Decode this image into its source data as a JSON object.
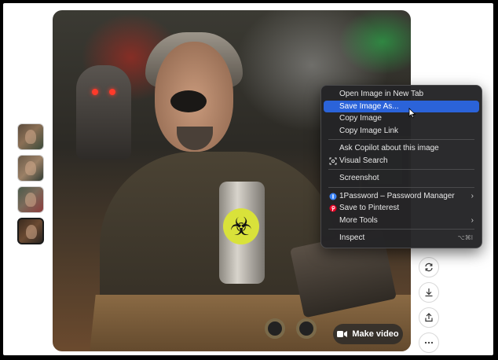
{
  "thumbnails": [
    {
      "alt": "thumbnail 1"
    },
    {
      "alt": "thumbnail 2"
    },
    {
      "alt": "thumbnail 3"
    },
    {
      "alt": "thumbnail 4",
      "selected": true
    }
  ],
  "image": {
    "make_video_label": "Make video"
  },
  "context_menu": {
    "items": [
      {
        "label": "Open Image in New Tab"
      },
      {
        "label": "Save Image As...",
        "highlighted": true
      },
      {
        "label": "Copy Image"
      },
      {
        "label": "Copy Image Link"
      },
      {
        "label": "Ask Copilot about this image"
      },
      {
        "label": "Visual Search",
        "icon": "visual-search-icon"
      },
      {
        "label": "Screenshot"
      },
      {
        "label": "1Password – Password Manager",
        "icon": "1password-icon",
        "submenu": true
      },
      {
        "label": "Save to Pinterest",
        "icon": "pinterest-icon"
      },
      {
        "label": "More Tools",
        "submenu": true
      },
      {
        "label": "Inspect",
        "shortcut": "⌥⌘I"
      }
    ]
  },
  "actions": [
    {
      "icon": "refresh-icon"
    },
    {
      "icon": "download-icon"
    },
    {
      "icon": "share-icon"
    },
    {
      "icon": "more-icon"
    }
  ],
  "colors": {
    "menu_bg": "#242426",
    "menu_highlight": "#2b63d9",
    "biohazard_yellow": "#d9e23a"
  }
}
